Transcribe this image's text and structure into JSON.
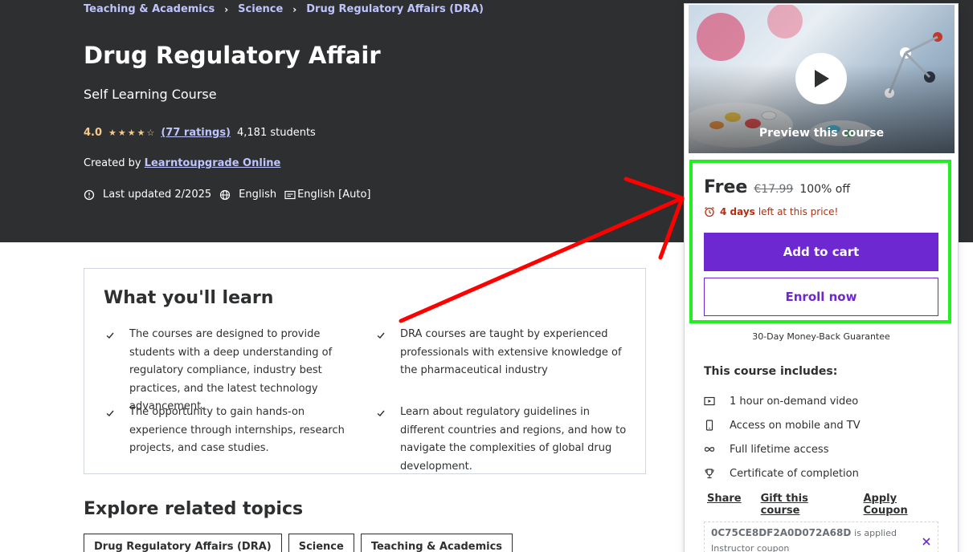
{
  "breadcrumb": [
    "Teaching & Academics",
    "Science",
    "Drug Regulatory Affairs (DRA)"
  ],
  "breadcrumb_sep": "›",
  "course": {
    "title": "Drug Regulatory Affair",
    "subtitle": "Self Learning Course",
    "rating": "4.0",
    "ratings_count": "(77 ratings)",
    "students": "4,181 students",
    "created_by_label": "Created by",
    "author": "Learntoupgrade Online",
    "last_updated": "Last updated 2/2025",
    "language": "English",
    "captions": "English [Auto]",
    "star_rating": 4
  },
  "learn": {
    "title": "What you'll learn",
    "items": [
      "The courses are designed to provide students with a deep understanding of regulatory compliance, industry best practices, and the latest technology advancement.",
      "DRA courses are taught by experienced professionals with extensive knowledge of the pharmaceutical industry",
      "The opportunity to gain hands-on experience through internships, research projects, and case studies.",
      "Learn about regulatory guidelines in different countries and regions, and how to navigate the complexities of global drug development."
    ]
  },
  "explore": {
    "title": "Explore related topics",
    "topics": [
      "Drug Regulatory Affairs (DRA)",
      "Science",
      "Teaching & Academics"
    ]
  },
  "sidebar": {
    "preview_label": "Preview this course",
    "price": "Free",
    "original_price": "€17.99",
    "discount": "100% off",
    "timer_days": "4 days",
    "timer_text": "left at this price!",
    "add_to_cart": "Add to cart",
    "enroll_now": "Enroll now",
    "guarantee": "30-Day Money-Back Guarantee",
    "includes_title": "This course includes:",
    "includes": [
      {
        "icon": "video-icon",
        "text": "1 hour on-demand video"
      },
      {
        "icon": "mobile-icon",
        "text": "Access on mobile and TV"
      },
      {
        "icon": "infinity-icon",
        "text": "Full lifetime access"
      },
      {
        "icon": "trophy-icon",
        "text": "Certificate of completion"
      }
    ],
    "links": [
      "Share",
      "Gift this course",
      "Apply Coupon"
    ],
    "coupon_code": "0C75CE8DF2A0D072A68D",
    "coupon_applied": "is applied",
    "coupon_type": "Instructor coupon"
  },
  "colors": {
    "hero_bg": "#2d2f31",
    "accent_purple": "#6d28d2",
    "link_lavender": "#c0c4fc",
    "star_gold": "#f3ca8c",
    "highlight_green": "#22ee22",
    "annotation_red": "#ff0000"
  }
}
